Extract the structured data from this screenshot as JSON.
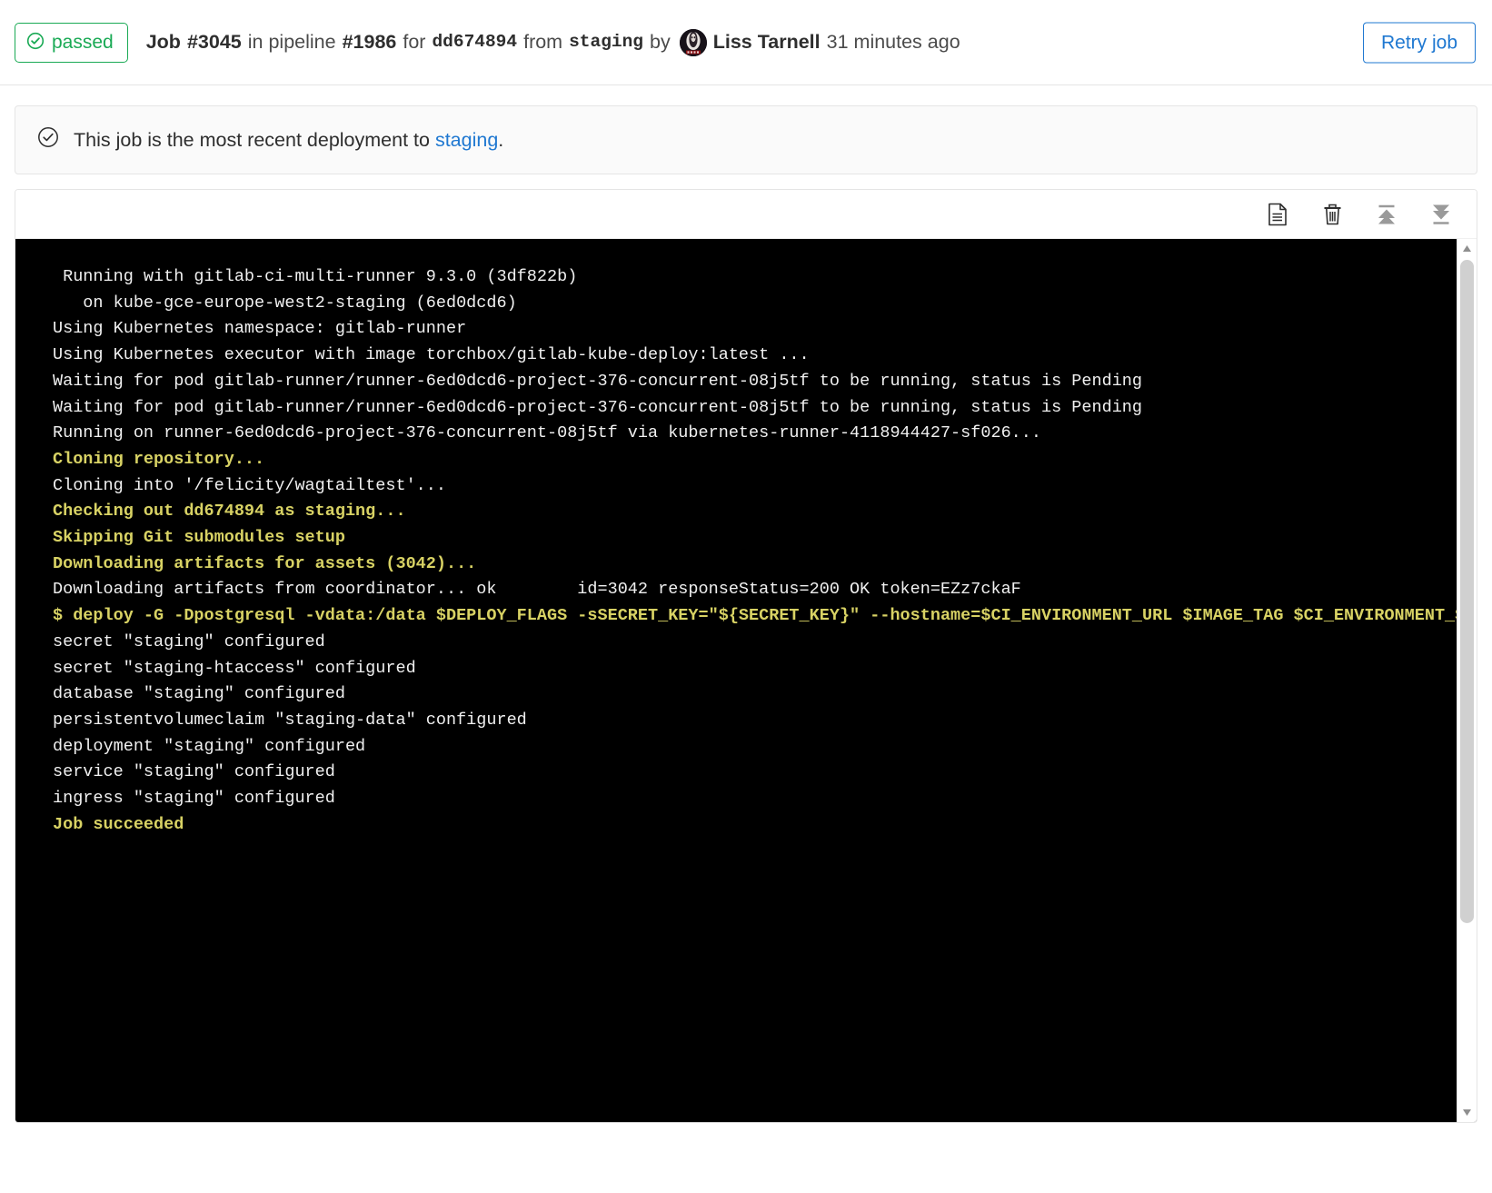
{
  "header": {
    "status": "passed",
    "status_icon": "check-circle-icon",
    "status_color": "#1aaa55",
    "job_label": "Job",
    "job_id": "#3045",
    "in_text": "in pipeline",
    "pipeline_id": "#1986",
    "for_text": "for",
    "commit_sha": "dd674894",
    "from_text": "from",
    "branch": "staging",
    "by_text": "by",
    "author": "Liss Tarnell",
    "timestamp": "31 minutes ago",
    "retry_label": "Retry job",
    "retry_color": "#1f78d1"
  },
  "alert": {
    "icon": "check-circle-icon",
    "text_before": "This job is the most recent deployment to",
    "link_text": "staging",
    "text_after": ".",
    "link_color": "#1f78d1"
  },
  "toolbar": {
    "icons": [
      {
        "name": "raw-log-icon",
        "title": "Show complete raw"
      },
      {
        "name": "trash-icon",
        "title": "Erase job log"
      },
      {
        "name": "scroll-to-top-icon",
        "title": "Scroll to top"
      },
      {
        "name": "scroll-to-bottom-icon",
        "title": "Scroll to bottom"
      }
    ]
  },
  "log": {
    "highlight_color": "#d8d264",
    "text_color": "#f0f0f0",
    "background": "#000000",
    "lines": [
      {
        "text": " Running with gitlab-ci-multi-runner 9.3.0 (3df822b)",
        "hl": false
      },
      {
        "text": "   on kube-gce-europe-west2-staging (6ed0dcd6)",
        "hl": false
      },
      {
        "text": "Using Kubernetes namespace: gitlab-runner",
        "hl": false
      },
      {
        "text": "Using Kubernetes executor with image torchbox/gitlab-kube-deploy:latest ...",
        "hl": false
      },
      {
        "text": "Waiting for pod gitlab-runner/runner-6ed0dcd6-project-376-concurrent-08j5tf to be running, status is Pending",
        "hl": false
      },
      {
        "text": "Waiting for pod gitlab-runner/runner-6ed0dcd6-project-376-concurrent-08j5tf to be running, status is Pending",
        "hl": false
      },
      {
        "text": "Running on runner-6ed0dcd6-project-376-concurrent-08j5tf via kubernetes-runner-4118944427-sf026...",
        "hl": false
      },
      {
        "text": "Cloning repository...",
        "hl": true
      },
      {
        "text": "Cloning into '/felicity/wagtailtest'...",
        "hl": false
      },
      {
        "text": "Checking out dd674894 as staging...",
        "hl": true
      },
      {
        "text": "Skipping Git submodules setup",
        "hl": true
      },
      {
        "text": "Downloading artifacts for assets (3042)...",
        "hl": true
      },
      {
        "text": "Downloading artifacts from coordinator... ok        id=3042 responseStatus=200 OK token=EZz7ckaF",
        "hl": false
      },
      {
        "text": "$ deploy -G -Dpostgresql -vdata:/data $DEPLOY_FLAGS -sSECRET_KEY=\"${SECRET_KEY}\" --hostname=$CI_ENVIRONMENT_URL $IMAGE_TAG $CI_ENVIRONMENT_SLUG",
        "hl": true
      },
      {
        "text": "secret \"staging\" configured",
        "hl": false
      },
      {
        "text": "secret \"staging-htaccess\" configured",
        "hl": false
      },
      {
        "text": "database \"staging\" configured",
        "hl": false
      },
      {
        "text": "persistentvolumeclaim \"staging-data\" configured",
        "hl": false
      },
      {
        "text": "deployment \"staging\" configured",
        "hl": false
      },
      {
        "text": "service \"staging\" configured",
        "hl": false
      },
      {
        "text": "ingress \"staging\" configured",
        "hl": false
      },
      {
        "text": "Job succeeded",
        "hl": true
      }
    ]
  }
}
